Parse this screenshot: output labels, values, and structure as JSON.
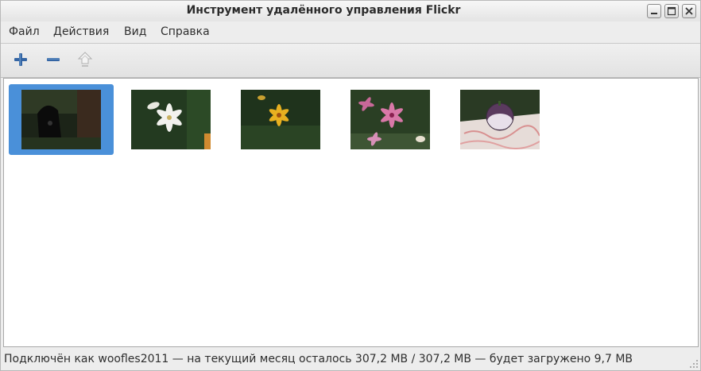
{
  "window": {
    "title": "Инструмент удалённого управления Flickr",
    "controls": [
      "minimize-icon",
      "maximize-icon",
      "close-icon"
    ]
  },
  "menubar": {
    "items": [
      {
        "label": "Файл"
      },
      {
        "label": "Действия"
      },
      {
        "label": "Вид"
      },
      {
        "label": "Справка"
      }
    ]
  },
  "toolbar": {
    "buttons": [
      {
        "icon": "add-icon",
        "color": "#3465a4"
      },
      {
        "icon": "remove-icon",
        "color": "#3465a4"
      },
      {
        "icon": "upload-icon",
        "color": "#b0b0b0"
      }
    ]
  },
  "photos": [
    {
      "icon": "photo-dog",
      "selected": true
    },
    {
      "icon": "photo-white-lily",
      "selected": false
    },
    {
      "icon": "photo-yellow-lily",
      "selected": false
    },
    {
      "icon": "photo-pink-lily",
      "selected": false
    },
    {
      "icon": "photo-purple-vegetable",
      "selected": false
    }
  ],
  "colors": {
    "selection": "#4a90d9"
  },
  "status": {
    "text": "Подключён как woofles2011 — на текущий месяц осталось 307,2 MB / 307,2 MB — будет загружено 9,7 MB"
  }
}
